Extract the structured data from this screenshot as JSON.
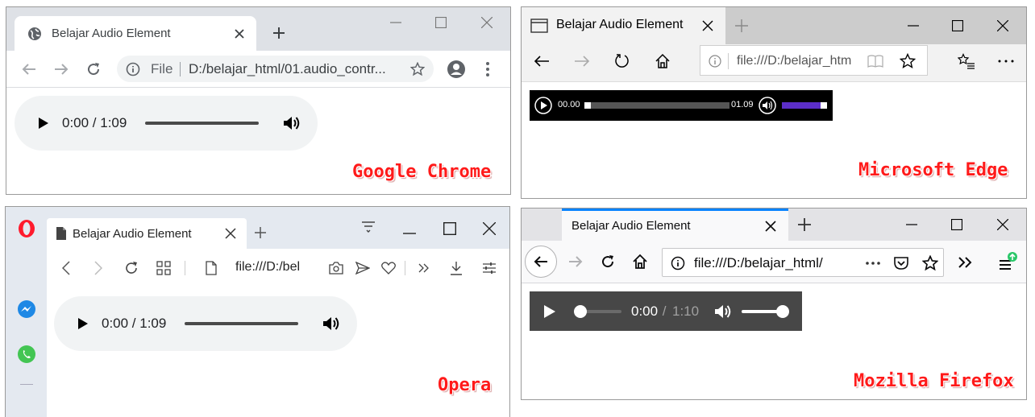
{
  "chrome": {
    "tab_title": "Belajar Audio Element",
    "url_scheme": "File",
    "url_path": "D:/belajar_html/01.audio_contr...",
    "player_time": "0:00 / 1:09",
    "browser_label": "Google Chrome"
  },
  "edge": {
    "tab_title": "Belajar Audio Element",
    "url": "file:///D:/belajar_htm",
    "player_current": "00.00",
    "player_duration": "01.09",
    "browser_label": "Microsoft Edge",
    "accent_color": "#5b2ec8"
  },
  "opera": {
    "tab_title": "Belajar Audio Element",
    "url": "file:///D:/bel",
    "player_time": "0:00 / 1:09",
    "browser_label": "Opera",
    "brand_color": "#ff1b2d"
  },
  "firefox": {
    "tab_title": "Belajar Audio Element",
    "url": "file:///D:/belajar_html/",
    "player_current": "0:00",
    "player_separator": " / ",
    "player_duration": "1:10",
    "browser_label": "Mozilla Firefox",
    "tab_accent_color": "#0a84ff"
  },
  "icons": {
    "globe": "globe-icon",
    "close": "close-icon",
    "new_tab": "plus-icon",
    "back": "back-arrow-icon",
    "forward": "forward-arrow-icon",
    "reload": "reload-icon",
    "home": "home-icon",
    "info": "info-icon",
    "star": "star-icon",
    "account": "account-icon",
    "menu": "menu-icon",
    "play": "play-icon",
    "volume": "volume-icon"
  }
}
